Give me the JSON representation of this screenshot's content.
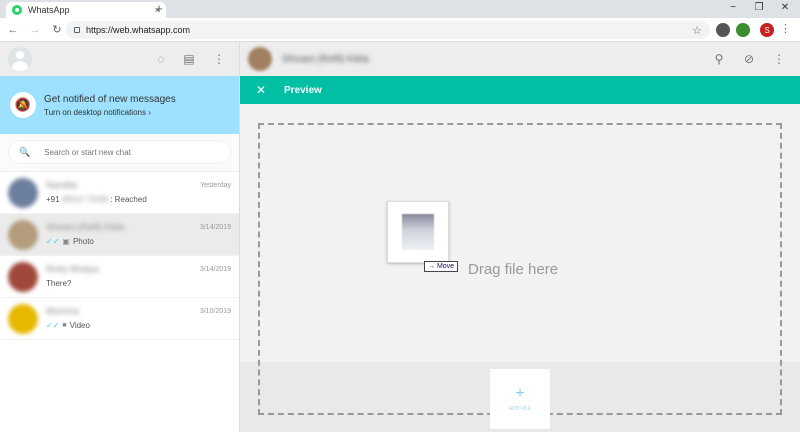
{
  "browser": {
    "tab_title": "WhatsApp",
    "tab_close": "×",
    "new_tab": "+",
    "url": "https://web.whatsapp.com",
    "profile_initial": "S"
  },
  "notification": {
    "title": "Get notified of new messages",
    "link": "Turn on desktop notifications ›"
  },
  "search": {
    "placeholder": "Search or start new chat"
  },
  "chats": [
    {
      "name": "Nandita",
      "msg_prefix": "+91",
      "msg_hidden": "99910 75588",
      "msg_suffix": ": Reached",
      "date": "Yesterday",
      "avatar": "#6d7f9e"
    },
    {
      "name": "Shivani (Refil) Kikla",
      "msg": "Photo",
      "date": "3/14/2019",
      "avatar": "#b39b7c",
      "active": true
    },
    {
      "name": "Ricky Bhatya",
      "msg": "There?",
      "date": "3/14/2019",
      "avatar": "#a0483c"
    },
    {
      "name": "Mumma",
      "msg": "Video",
      "date": "3/10/2019",
      "avatar": "#e6b800"
    }
  ],
  "conversation": {
    "contact_name": "Shivani (Refil) Kikla"
  },
  "preview": {
    "title": "Preview",
    "drag_text": "Drag file here",
    "move_label": "Move",
    "add_file_label": "ADD FILE"
  },
  "colors": {
    "accent": "#00bfa5",
    "notification_bg": "#9de1fe",
    "read_tick": "#4fc3f7"
  }
}
